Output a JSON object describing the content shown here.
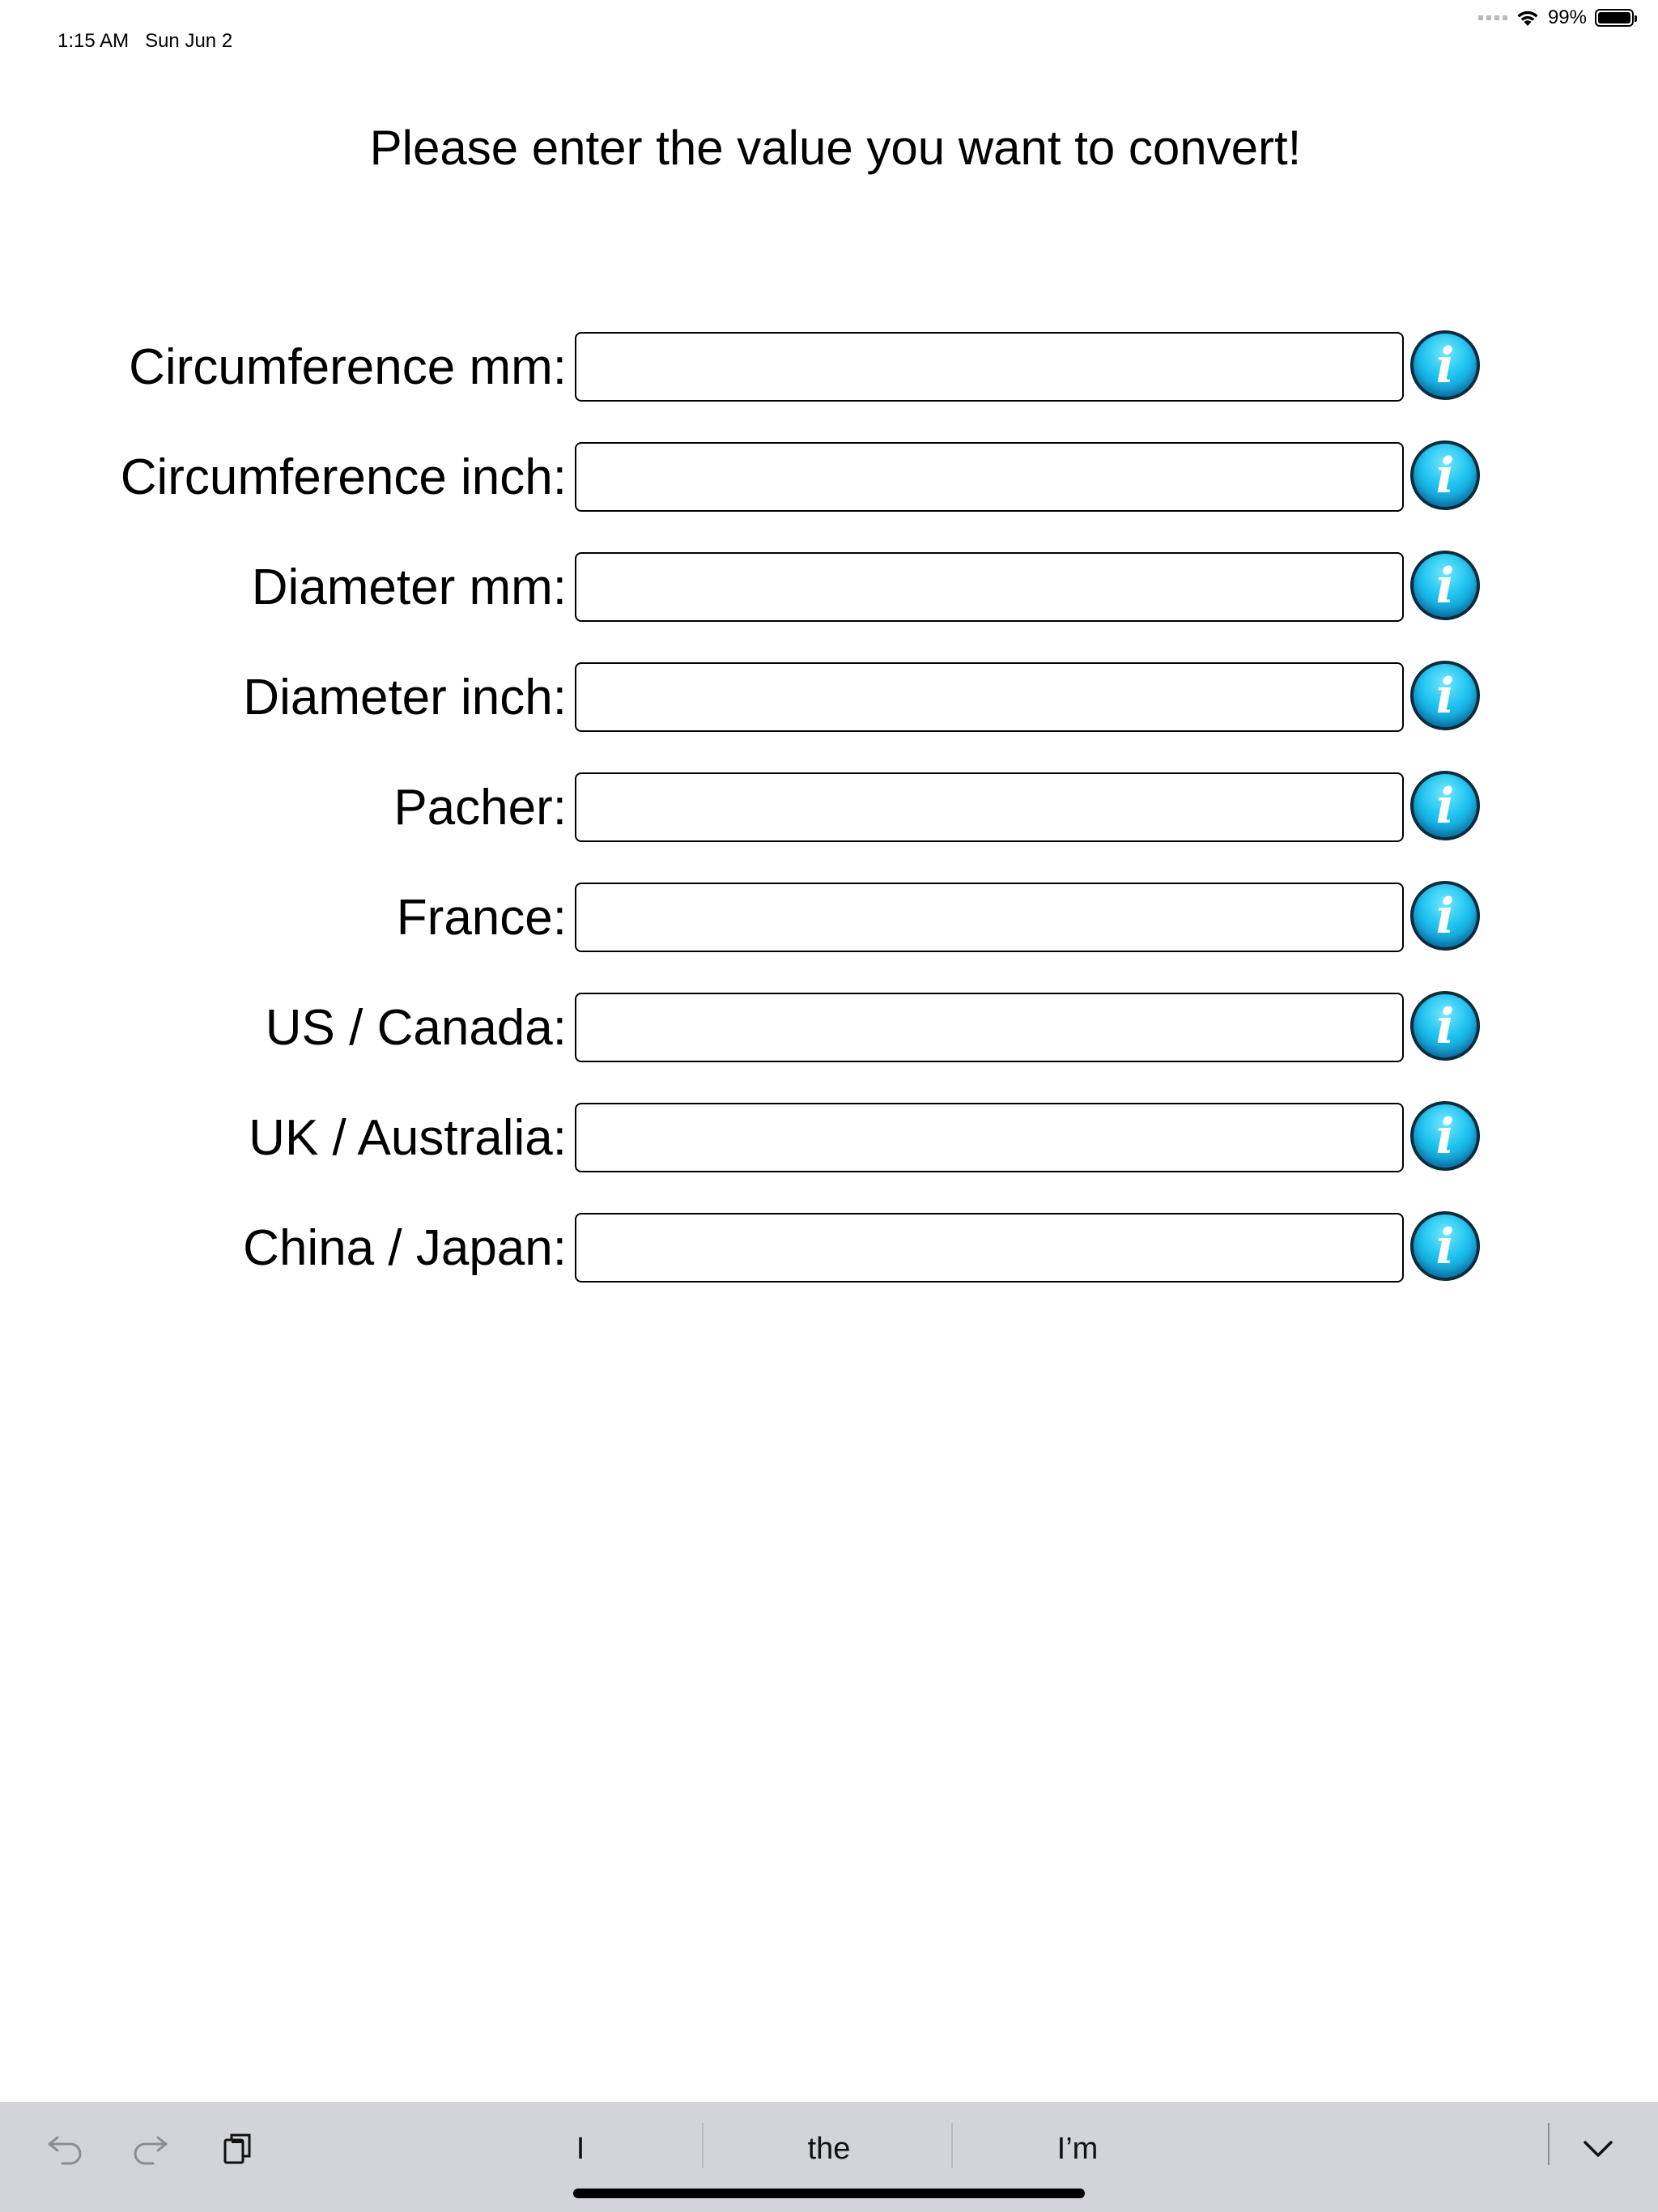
{
  "status_bar": {
    "time": "1:15 AM",
    "date": "Sun Jun 2",
    "battery": "99%",
    "battery_level": 0.99,
    "icons": [
      "cellular-dots-icon",
      "wifi-icon",
      "battery-icon"
    ]
  },
  "title": "Please enter the value you want to convert!",
  "fields": [
    {
      "id": "circumference-mm",
      "label": "Circumference mm:",
      "value": "",
      "placeholder": ""
    },
    {
      "id": "circumference-inch",
      "label": "Circumference inch:",
      "value": "",
      "placeholder": ""
    },
    {
      "id": "diameter-mm",
      "label": "Diameter mm:",
      "value": "",
      "placeholder": ""
    },
    {
      "id": "diameter-inch",
      "label": "Diameter inch:",
      "value": "",
      "placeholder": ""
    },
    {
      "id": "pacher",
      "label": "Pacher:",
      "value": "",
      "placeholder": ""
    },
    {
      "id": "france",
      "label": "France:",
      "value": "",
      "placeholder": ""
    },
    {
      "id": "us-canada",
      "label": "US / Canada:",
      "value": "",
      "placeholder": ""
    },
    {
      "id": "uk-australia",
      "label": "UK / Australia:",
      "value": "",
      "placeholder": ""
    },
    {
      "id": "china-japan",
      "label": "China / Japan:",
      "value": "",
      "placeholder": ""
    }
  ],
  "info_button": {
    "glyph": "i",
    "icon": "info-icon",
    "color": "#1ec1ef"
  },
  "keyboard_bar": {
    "left_icons": [
      "undo-icon",
      "redo-icon",
      "paste-icon"
    ],
    "suggestions": [
      "I",
      "the",
      "I’m"
    ],
    "right_icon": "chevron-down-icon",
    "background": "#d2d4da"
  }
}
